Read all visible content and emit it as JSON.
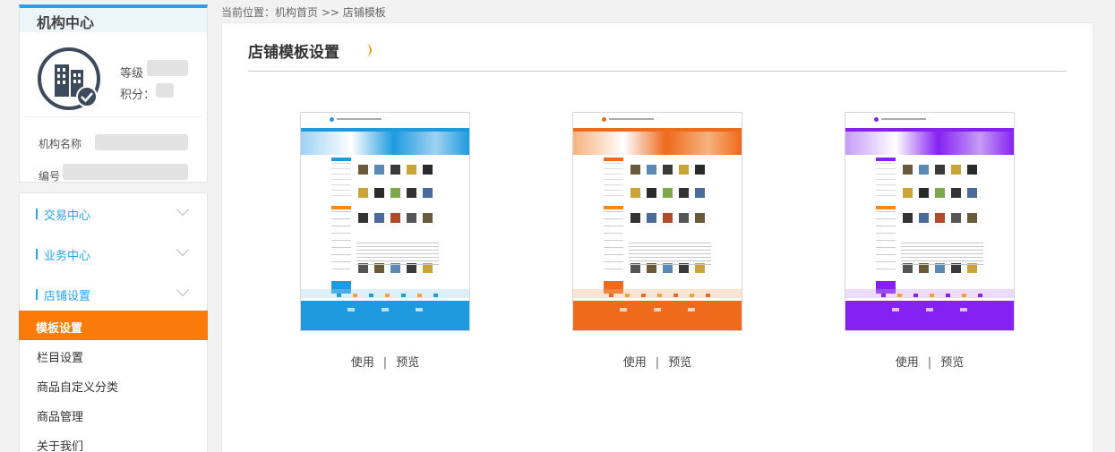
{
  "sidebar": {
    "center_title": "机构中心",
    "level_label": "等级",
    "points_label": "积分：",
    "org_name_label": "机构名称",
    "org_id_label": "编号",
    "sections": [
      {
        "label": "交易中心"
      },
      {
        "label": "业务中心"
      },
      {
        "label": "店铺设置"
      }
    ],
    "sub_items": [
      {
        "label": "模板设置",
        "active": true
      },
      {
        "label": "栏目设置",
        "active": false
      },
      {
        "label": "商品自定义分类",
        "active": false
      },
      {
        "label": "商品管理",
        "active": false
      },
      {
        "label": "关于我们",
        "active": false
      }
    ]
  },
  "breadcrumb": "当前位置：机构首页 >> 店铺模板",
  "main": {
    "title": "店铺模板设置",
    "templates": [
      {
        "theme": "blue",
        "color": "#1e9be0",
        "light": "#9fd2f3",
        "use_label": "使用",
        "separator": "|",
        "preview_label": "预览"
      },
      {
        "theme": "orange",
        "color": "#ee6a1c",
        "light": "#f6b27d",
        "use_label": "使用",
        "separator": "|",
        "preview_label": "预览"
      },
      {
        "theme": "purple",
        "color": "#8522f2",
        "light": "#c59cf5",
        "use_label": "使用",
        "separator": "|",
        "preview_label": "预览"
      }
    ]
  },
  "colors": {
    "accent": "#29a3e6",
    "active_bg": "#fa7a0a"
  }
}
